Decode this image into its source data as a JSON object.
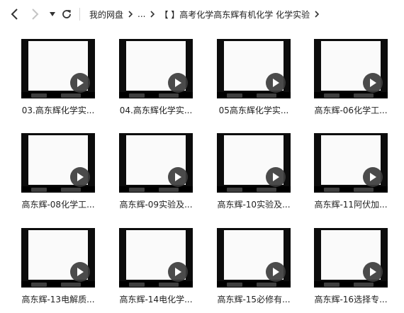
{
  "nav": {
    "back_icon": "chevron-left-icon",
    "forward_icon": "chevron-right-icon",
    "dropdown_icon": "caret-down-icon",
    "refresh_icon": "refresh-icon"
  },
  "breadcrumb": {
    "root": "我的网盘",
    "ellipsis": "...",
    "current": "【 】高考化学高东辉有机化学 化学实验"
  },
  "videos": [
    {
      "title": "03.高东辉化学实..."
    },
    {
      "title": "04.高东辉化学实..."
    },
    {
      "title": "05高东辉化学实..."
    },
    {
      "title": "高东辉-06化学工..."
    },
    {
      "title": "高东辉-08化学工..."
    },
    {
      "title": "高东辉-09实验及..."
    },
    {
      "title": "高东辉-10实验及..."
    },
    {
      "title": "高东辉-11阿伏加..."
    },
    {
      "title": "高东辉-13电解质..."
    },
    {
      "title": "高东辉-14电化学..."
    },
    {
      "title": "高东辉-15必修有..."
    },
    {
      "title": "高东辉-16选择专..."
    }
  ],
  "colors": {
    "thumb_bg": "#0c0c0c",
    "play_bg": "#3c3c3c",
    "text": "#222222"
  }
}
